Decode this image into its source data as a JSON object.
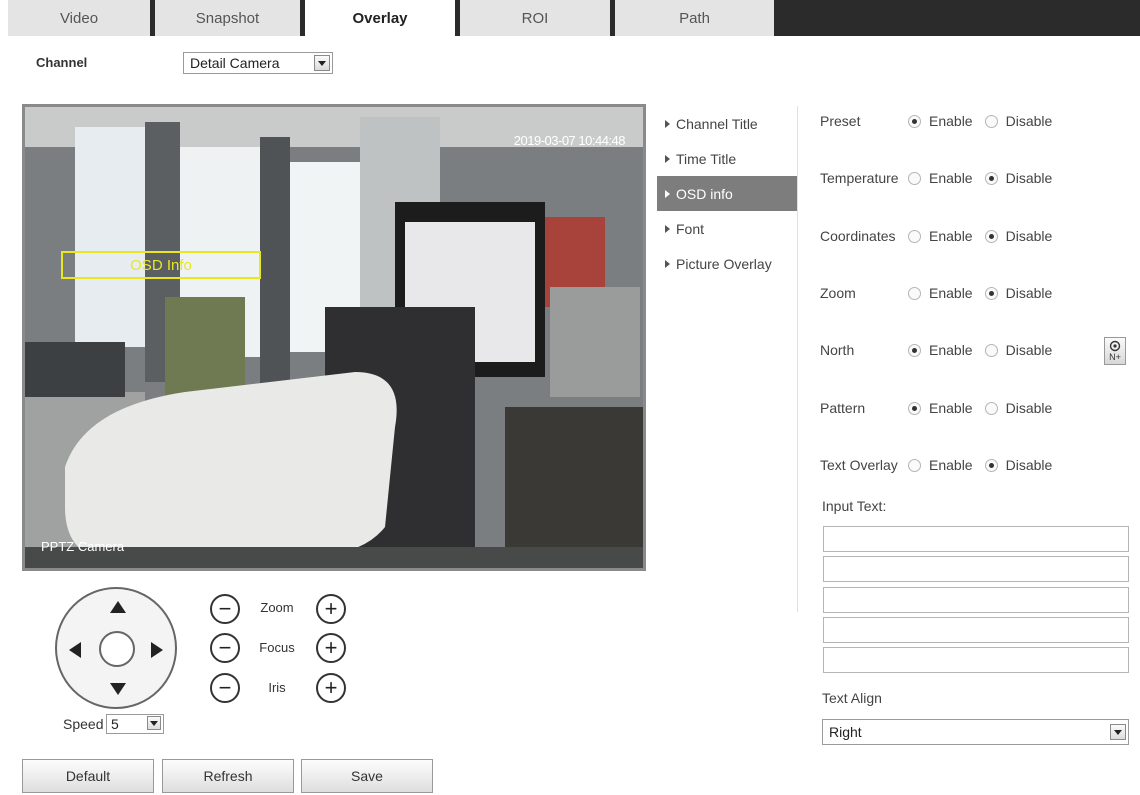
{
  "tabs": [
    "Video",
    "Snapshot",
    "Overlay",
    "ROI",
    "Path"
  ],
  "active_tab": "Overlay",
  "channel": {
    "label": "Channel",
    "value": "Detail Camera"
  },
  "video": {
    "timestamp": "2019-03-07 10:44:48",
    "camera_name": "PPTZ Camera",
    "osd_box_text": "OSD Info"
  },
  "menu": [
    "Channel Title",
    "Time Title",
    "OSD info",
    "Font",
    "Picture Overlay"
  ],
  "active_menu": "OSD info",
  "settings": {
    "enable_label": "Enable",
    "disable_label": "Disable",
    "rows": [
      {
        "label": "Preset",
        "value": "Enable"
      },
      {
        "label": "Temperature",
        "value": "Disable"
      },
      {
        "label": "Coordinates",
        "value": "Disable"
      },
      {
        "label": "Zoom",
        "value": "Disable"
      },
      {
        "label": "North",
        "value": "Enable"
      },
      {
        "label": "Pattern",
        "value": "Enable"
      },
      {
        "label": "Text Overlay",
        "value": "Disable"
      }
    ],
    "north_icon_text": "N+"
  },
  "input_text": {
    "label": "Input Text:",
    "values": [
      "",
      "",
      "",
      "",
      ""
    ]
  },
  "text_align": {
    "label": "Text Align",
    "value": "Right"
  },
  "ptz": {
    "zoom_label": "Zoom",
    "focus_label": "Focus",
    "iris_label": "Iris",
    "speed_label": "Speed",
    "speed_value": "5"
  },
  "buttons": {
    "default": "Default",
    "refresh": "Refresh",
    "save": "Save"
  },
  "colors": {
    "osd_box": "#e8e820",
    "active_menu_bg": "#7d7d7d",
    "tab_bar_dark": "#2b2b2b"
  }
}
